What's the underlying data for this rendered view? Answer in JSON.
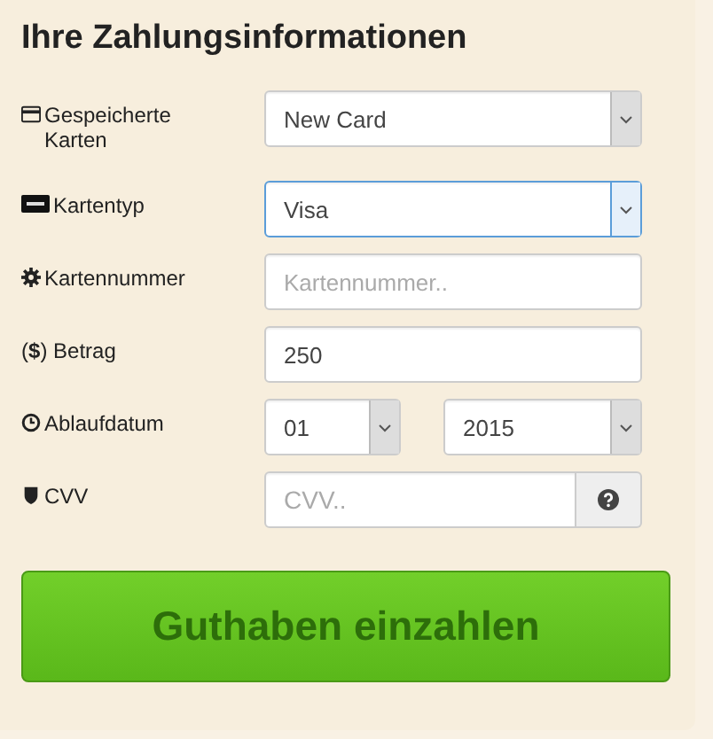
{
  "title": "Ihre Zahlungsinformationen",
  "fields": [
    {
      "label": "Gespeicherte Karten",
      "kind": "select",
      "value": "New Card",
      "focused": false
    },
    {
      "label": "Kartentyp",
      "kind": "select",
      "value": "Visa",
      "focused": true
    },
    {
      "label": "Kartennummer",
      "kind": "input",
      "placeholder": "Kartennummer..",
      "focused": false
    },
    {
      "label": "(**$**) Betrag",
      "kind": "input",
      "value": "250",
      "focused": false
    },
    {
      "label": "Ablaufdatum",
      "kind": "date",
      "values": [
        "01",
        "2015"
      ],
      "focused": false
    },
    {
      "label": "CVV",
      "kind": "addon",
      "placeholder": "CVV..",
      "focused": false
    }
  ],
  "submit": "Guthaben einzahlen"
}
